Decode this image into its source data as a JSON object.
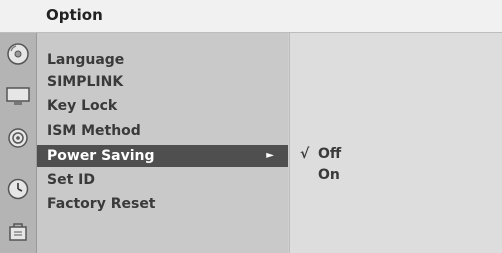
{
  "menu": {
    "title": "Option",
    "rail_icons": [
      "disc-icon",
      "monitor-icon",
      "speaker-icon",
      "clock-icon",
      "lock-icon"
    ],
    "items": [
      {
        "label": "Language"
      },
      {
        "label": "SIMPLINK"
      },
      {
        "label": "Key Lock"
      },
      {
        "label": "ISM Method"
      },
      {
        "label": "Power Saving",
        "selected": true
      },
      {
        "label": "Set ID"
      },
      {
        "label": "Factory Reset"
      }
    ],
    "submenu_arrow": "►",
    "options": [
      {
        "label": "Off",
        "checked": true,
        "check_mark": "√"
      },
      {
        "label": "On",
        "checked": false,
        "check_mark": ""
      }
    ]
  }
}
